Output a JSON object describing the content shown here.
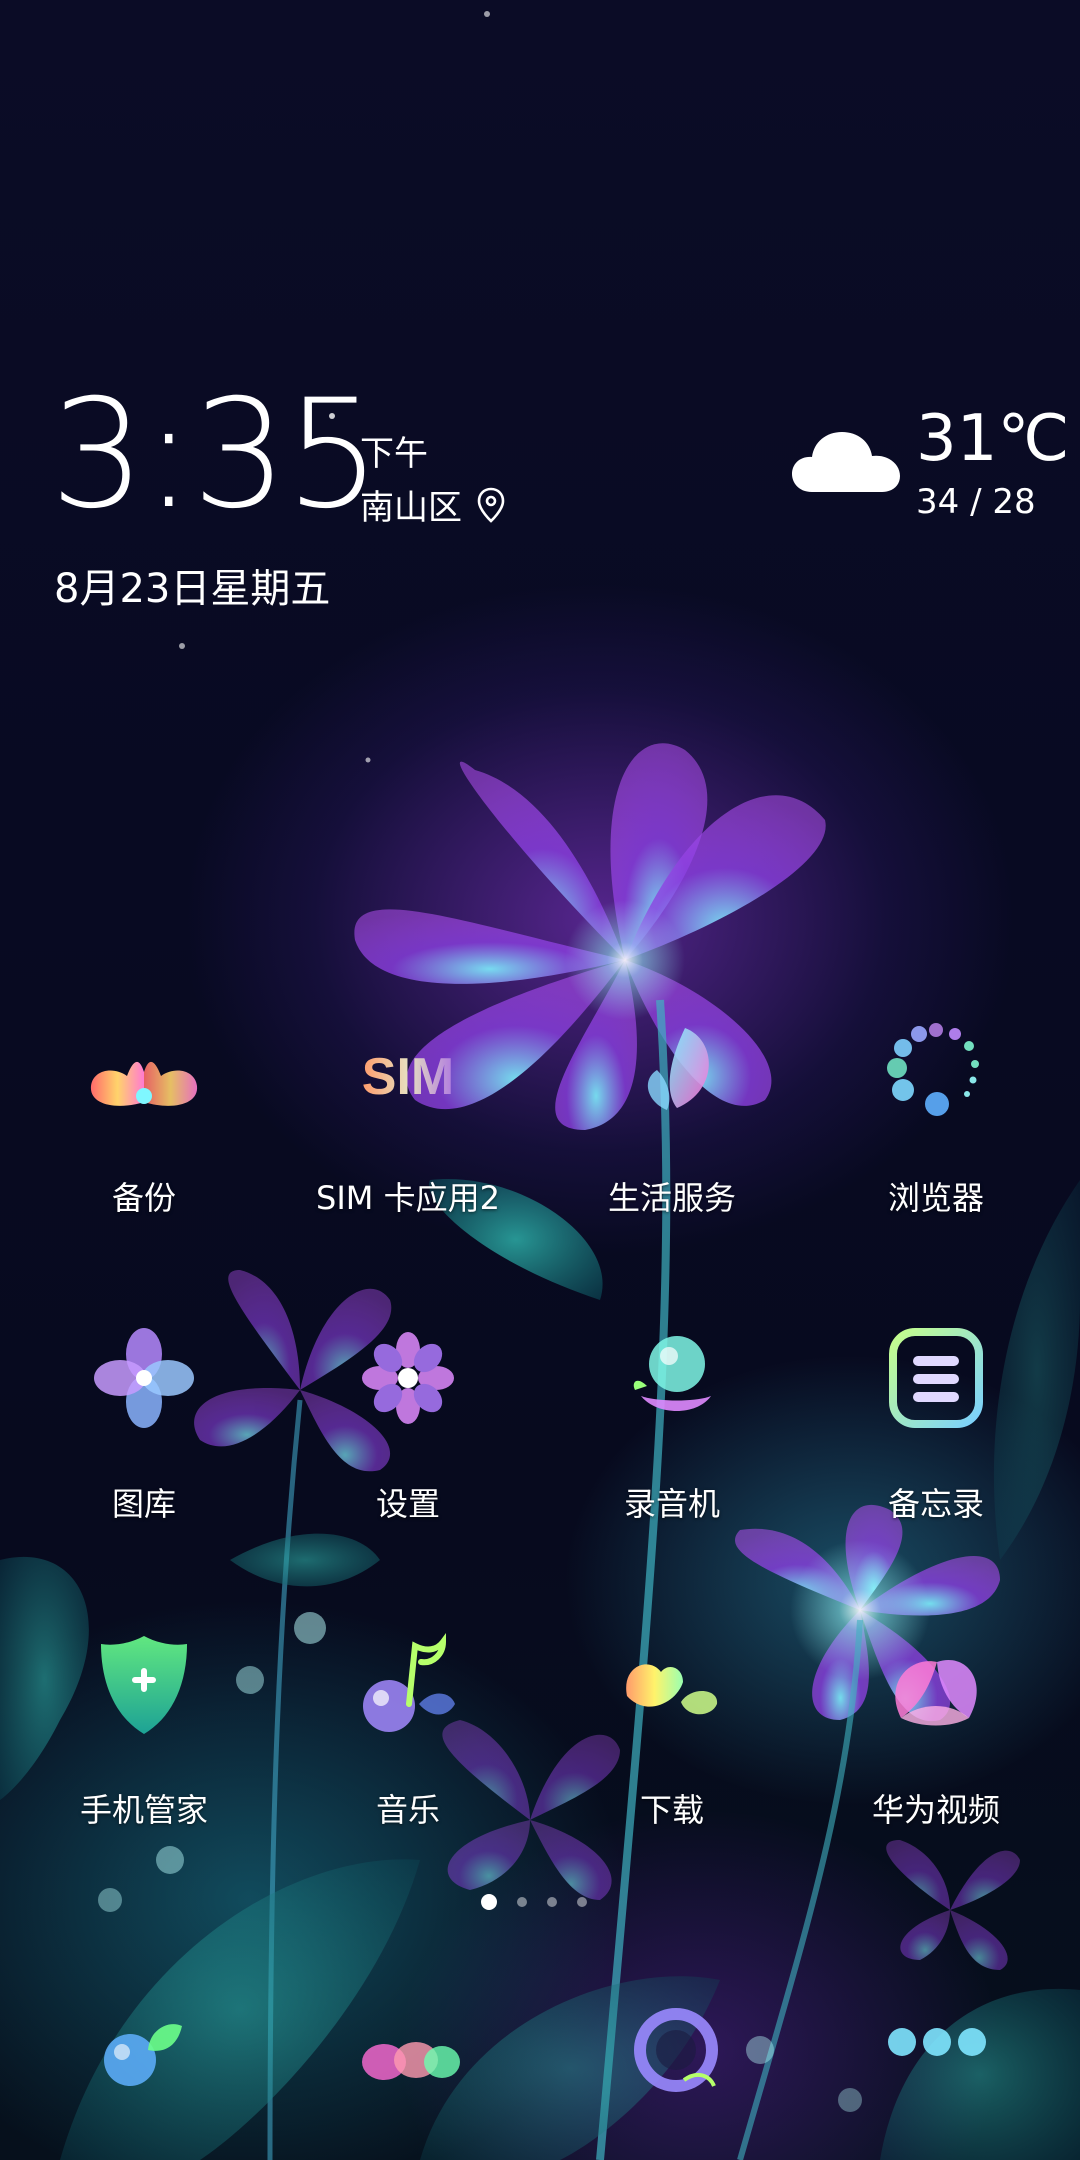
{
  "lockscreen": {
    "time": "3:35",
    "ampm": "下午",
    "location": "南山区",
    "date": "8月23日星期五"
  },
  "weather": {
    "temperature": "31℃",
    "range": "34 / 28",
    "icon": "cloud-icon"
  },
  "apps": [
    {
      "label": "备份",
      "icon": "backup-icon"
    },
    {
      "label": "SIM 卡应用2",
      "icon": "sim-card-icon",
      "icon_text": "SIM"
    },
    {
      "label": "生活服务",
      "icon": "life-services-icon"
    },
    {
      "label": "浏览器",
      "icon": "browser-icon"
    },
    {
      "label": "图库",
      "icon": "gallery-icon"
    },
    {
      "label": "设置",
      "icon": "settings-icon"
    },
    {
      "label": "录音机",
      "icon": "recorder-icon"
    },
    {
      "label": "备忘录",
      "icon": "notes-icon"
    },
    {
      "label": "手机管家",
      "icon": "phone-manager-icon"
    },
    {
      "label": "音乐",
      "icon": "music-icon"
    },
    {
      "label": "下载",
      "icon": "download-icon"
    },
    {
      "label": "华为视频",
      "icon": "huawei-video-icon"
    }
  ],
  "page_indicator": {
    "total": 4,
    "current": 1
  },
  "dock": [
    {
      "icon": "phone-icon"
    },
    {
      "icon": "messages-icon"
    },
    {
      "icon": "camera-icon"
    },
    {
      "icon": "app-drawer-icon"
    }
  ],
  "colors": {
    "accent_purple": "#9b3fe0",
    "accent_cyan": "#3fe0e0",
    "accent_pink": "#ff5fb0"
  }
}
